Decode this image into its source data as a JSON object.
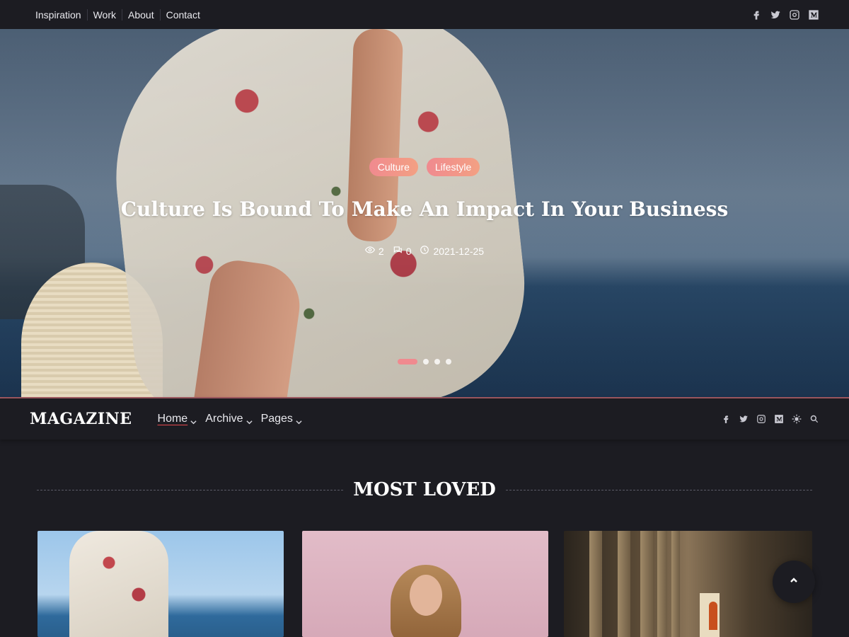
{
  "topbar": {
    "nav": [
      "Inspiration",
      "Work",
      "About",
      "Contact"
    ],
    "social": [
      "facebook-icon",
      "twitter-icon",
      "instagram-icon",
      "medium-icon"
    ]
  },
  "hero": {
    "tags": [
      "Culture",
      "Lifestyle"
    ],
    "title": "Culture Is Bound To Make An Impact In Your Business",
    "views": "2",
    "comments": "0",
    "date": "2021-12-25",
    "slides": 4,
    "active_slide": 1
  },
  "header": {
    "logo": "MAGAZINE",
    "menu": [
      {
        "label": "Home",
        "active": true
      },
      {
        "label": "Archive",
        "active": false
      },
      {
        "label": "Pages",
        "active": false
      }
    ]
  },
  "section": {
    "title": "MOST LOVED"
  },
  "colors": {
    "accent": "#f08a8f",
    "background": "#1c1c22"
  }
}
